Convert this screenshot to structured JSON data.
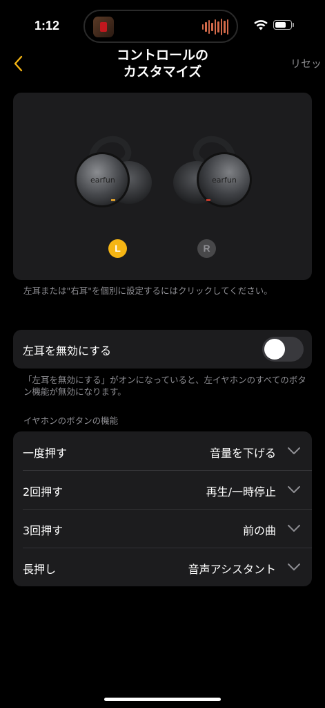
{
  "status_bar": {
    "time": "1:12",
    "wifi_icon": "wifi-icon",
    "battery_level": 0.75
  },
  "nav": {
    "back_icon": "chevron-left-icon",
    "title_line1": "コントロールの",
    "title_line2": "カスタマイズ",
    "reset_label": "リセット"
  },
  "earbuds": {
    "logo_left": "earfun",
    "logo_right": "earfun",
    "left_badge": "L",
    "right_badge": "R",
    "selected": "L",
    "note": "左耳または\"右耳\"を個別に設定するにはクリックしてください。"
  },
  "disable_left": {
    "label": "左耳を無効にする",
    "enabled": false,
    "note": "「左耳を無効にする」がオンになっていると、左イヤホンのすべてのボタン機能が無効になります。"
  },
  "button_functions": {
    "header": "イヤホンのボタンの機能",
    "rows": [
      {
        "label": "一度押す",
        "value": "音量を下げる"
      },
      {
        "label": "2回押す",
        "value": "再生/一時停止"
      },
      {
        "label": "3回押す",
        "value": "前の曲"
      },
      {
        "label": "長押し",
        "value": "音声アシスタント"
      }
    ]
  },
  "colors": {
    "accent": "#f5b514",
    "card_bg": "#1c1c1e",
    "secondary_text": "#8e8e93"
  }
}
